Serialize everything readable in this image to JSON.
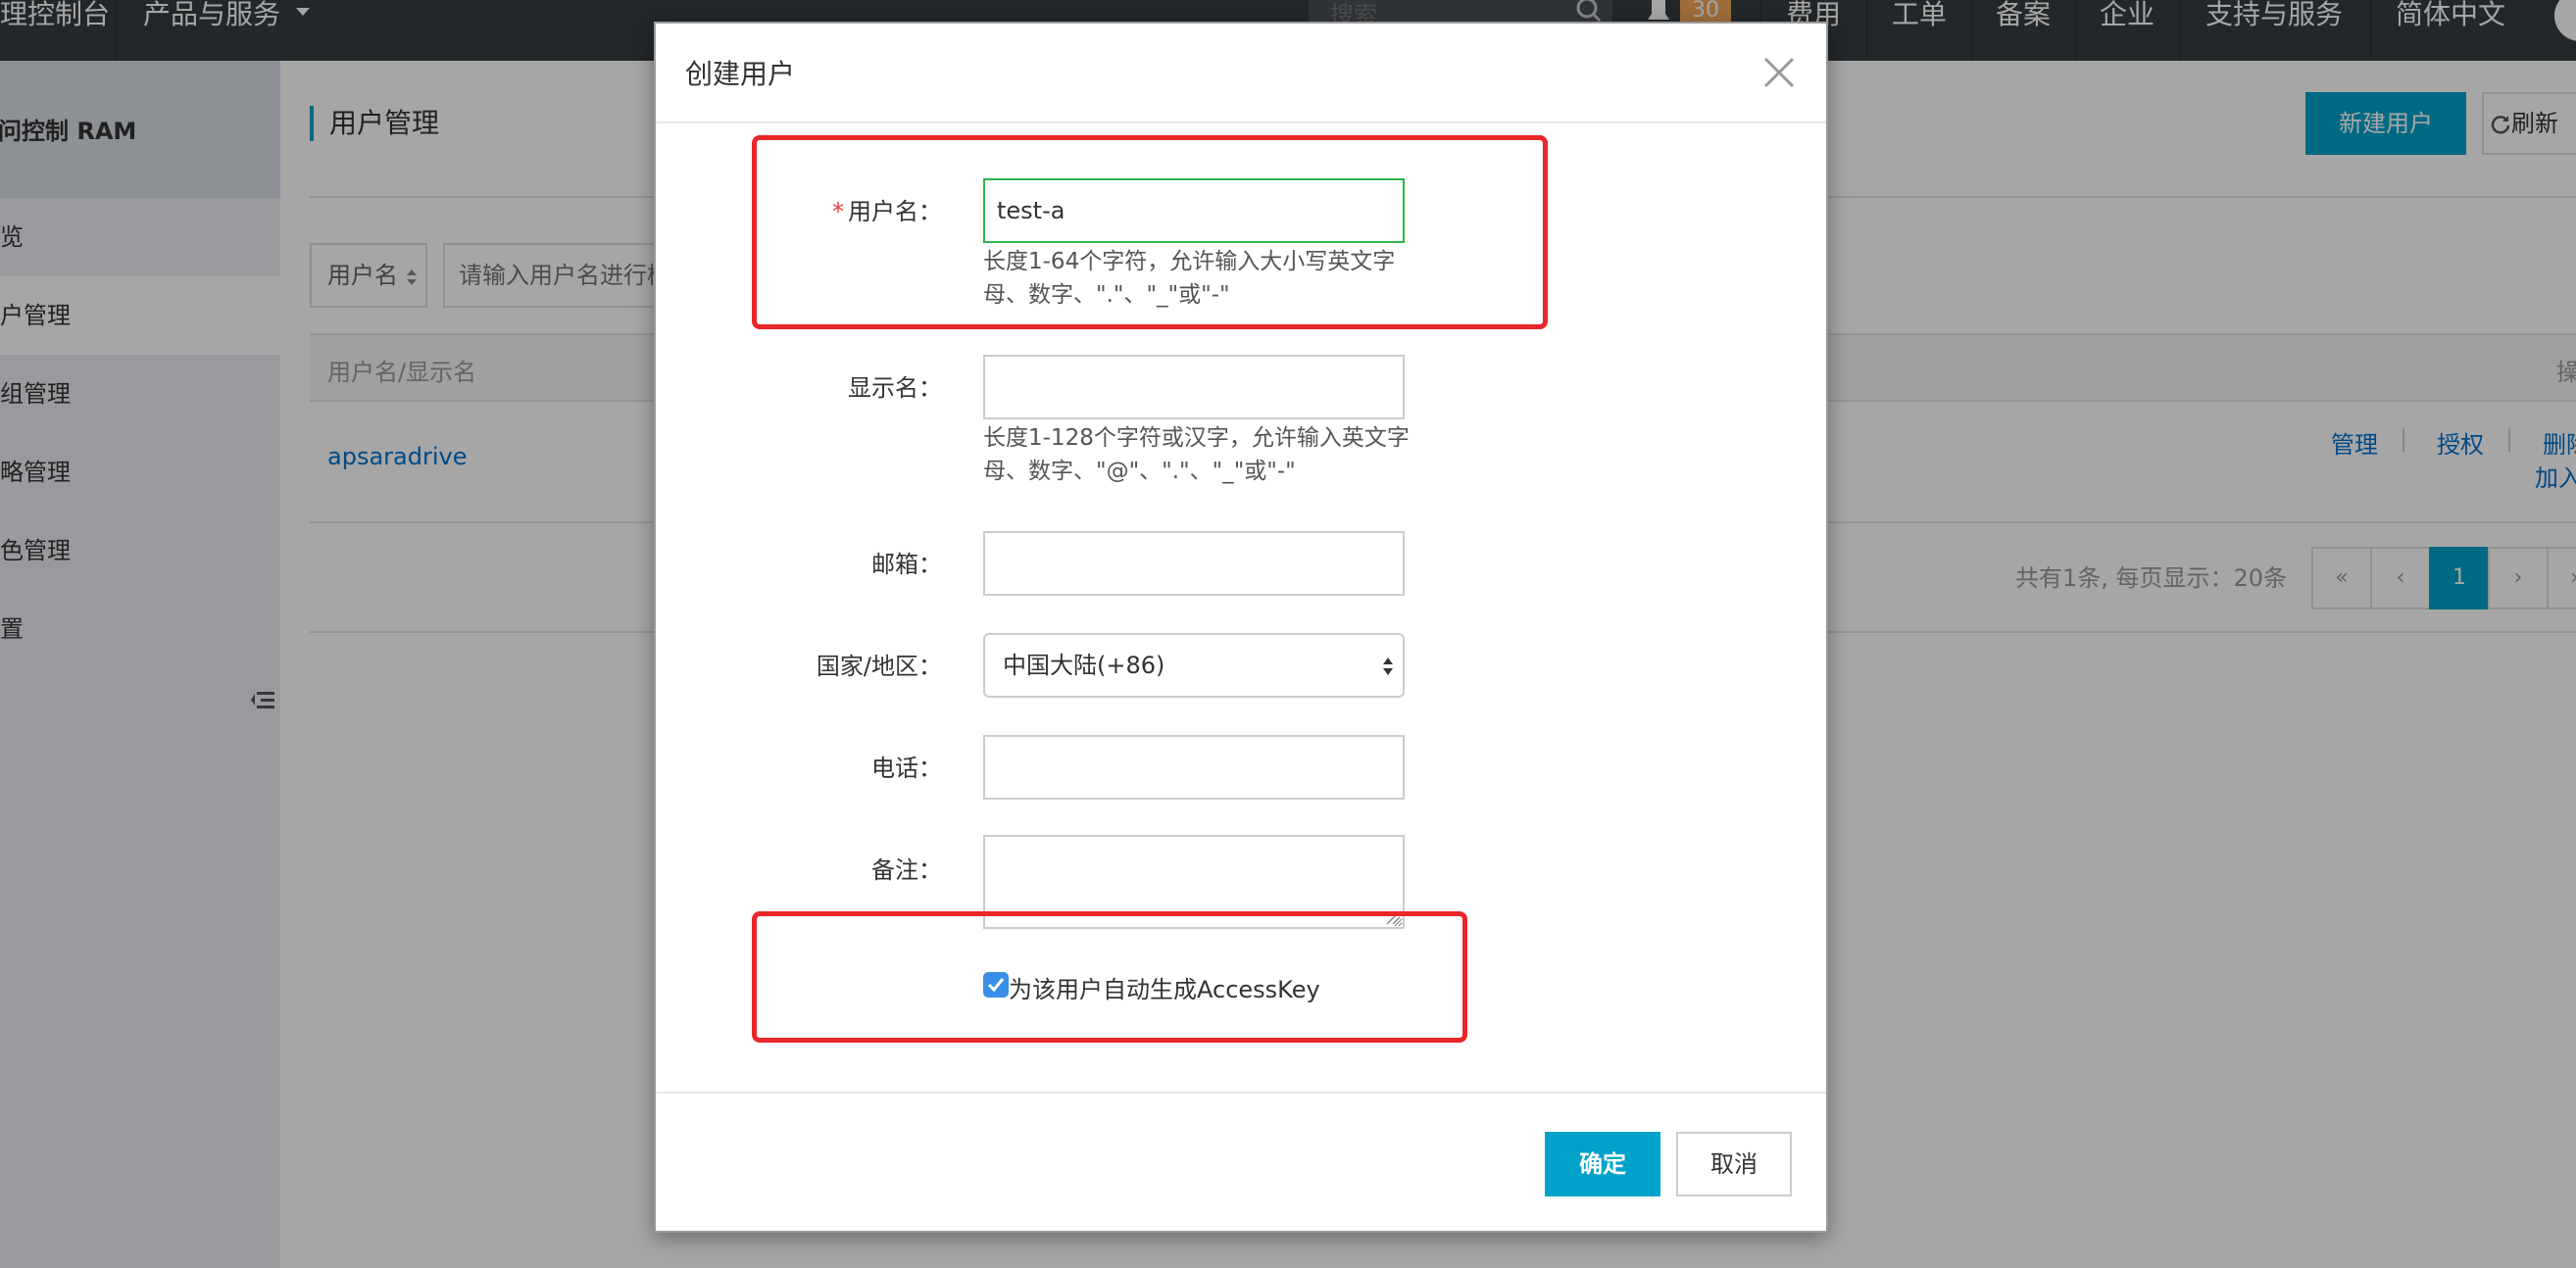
{
  "topbar": {
    "console_label": "理控制台",
    "products_label": "产品与服务",
    "search_placeholder": "搜索",
    "notification_count": "30",
    "links": [
      "费用",
      "工单",
      "备案",
      "企业",
      "支持与服务",
      "简体中文"
    ]
  },
  "sidebar": {
    "title": "访问控制 RAM",
    "items": [
      {
        "label": "概览"
      },
      {
        "label": "用户管理"
      },
      {
        "label": "群组管理"
      },
      {
        "label": "策略管理"
      },
      {
        "label": "角色管理"
      },
      {
        "label": "设置"
      }
    ]
  },
  "content": {
    "title": "用户管理",
    "new_user_button": "新建用户",
    "refresh_button": "刷新",
    "filter_select": "用户名",
    "filter_placeholder": "请输入用户名进行模糊查询",
    "table": {
      "col_name": "用户名/显示名",
      "col_actions": "操作",
      "rows": [
        {
          "name": "apsaradrive",
          "actions": [
            "管理",
            "授权",
            "删除",
            "加入组"
          ]
        }
      ]
    },
    "pager": {
      "summary": "共有1条, 每页显示：20条",
      "buttons": [
        "«",
        "‹",
        "1",
        "›",
        "»"
      ],
      "current_page": "1"
    }
  },
  "modal": {
    "title": "创建用户",
    "fields": {
      "username": {
        "label": "用户名：",
        "required_mark": "*",
        "value": "test-a",
        "hint": "长度1-64个字符，允许输入大小写英文字母、数字、\".\"、\"_\"或\"-\""
      },
      "display_name": {
        "label": "显示名：",
        "value": "",
        "hint": "长度1-128个字符或汉字，允许输入英文字母、数字、\"@\"、\".\"、\"_\"或\"-\""
      },
      "email": {
        "label": "邮箱：",
        "value": ""
      },
      "country": {
        "label": "国家/地区：",
        "value": "中国大陆(+86)"
      },
      "phone": {
        "label": "电话：",
        "value": ""
      },
      "remark": {
        "label": "备注：",
        "value": ""
      }
    },
    "checkbox_label": "为该用户自动生成AccessKey",
    "confirm_button": "确定",
    "cancel_button": "取消"
  },
  "colors": {
    "topbar": "#373d41",
    "accent": "#00a2ca",
    "annotation": "#e9262a",
    "input_focus": "#2cb64a"
  }
}
